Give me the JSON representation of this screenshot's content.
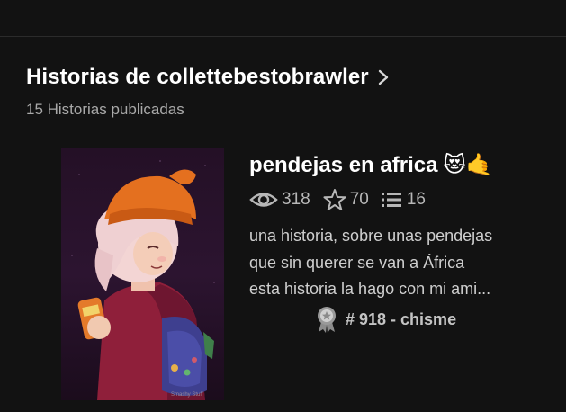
{
  "section": {
    "title": "Historias de collettebestobrawler",
    "subtitle": "15 Historias publicadas"
  },
  "story": {
    "title": "pendejas en africa",
    "emojis": "😻🤙",
    "reads": "318",
    "votes": "70",
    "parts": "16",
    "description_lines": [
      "una historia, sobre unas pendejas",
      "que sin querer se van a África",
      "esta historia la hago con mi ami..."
    ],
    "rank": "# 918 - chisme",
    "cover_signature": "Smashy Stuff"
  },
  "icons": {
    "header_arrow": "chevron-right-icon",
    "reads": "eye-icon",
    "votes": "star-icon",
    "parts": "list-icon",
    "rank": "award-medal-icon"
  },
  "colors": {
    "background": "#121212",
    "primary_text": "#ffffff",
    "secondary_text": "#a9a9a9",
    "stat_text": "#b7b7b7",
    "divider": "#2b2b2b"
  }
}
